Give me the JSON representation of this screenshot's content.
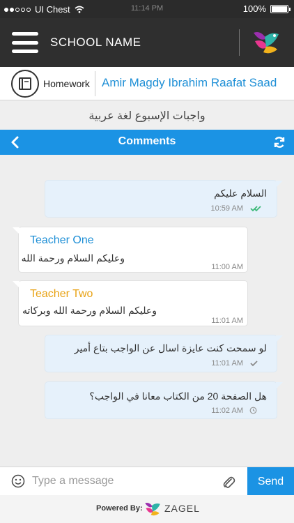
{
  "status_bar": {
    "carrier": "UI Chest",
    "time": "11:14 PM",
    "battery": "100%"
  },
  "header": {
    "school_name": "SCHOOL NAME"
  },
  "sub_header": {
    "section_label": "Homework",
    "student_name": "Amir Magdy Ibrahim Raafat Saad"
  },
  "homework_title": "واجبات الإسبوع لغة عربية",
  "comments_bar": {
    "title": "Comments"
  },
  "messages": [
    {
      "direction": "out",
      "text": "السلام عليكم",
      "time": "10:59 AM",
      "status": "read"
    },
    {
      "direction": "in",
      "sender": "Teacher One",
      "sender_color": "#1e8fd6",
      "text": "وعليكم السلام ورحمة الله",
      "time": "11:00 AM"
    },
    {
      "direction": "in",
      "sender": "Teacher Two",
      "sender_color": "#e8a214",
      "text": "وعليكم السلام ورحمة الله وبركاته",
      "time": "11:01 AM"
    },
    {
      "direction": "out",
      "text": "لو سمحت كنت عايزة اسال عن الواجب بتاع أمير",
      "time": "11:01 AM",
      "status": "sent"
    },
    {
      "direction": "out",
      "text": "هل الصفحة 20 من الكتاب معانا في الواجب؟",
      "time": "11:02 AM",
      "status": "pending"
    }
  ],
  "input": {
    "placeholder": "Type a message",
    "value": "",
    "send_label": "Send"
  },
  "footer": {
    "powered_by": "Powered By:",
    "brand": "ZAGEL"
  },
  "colors": {
    "accent": "#1b93e4",
    "header_bg": "#2f2f2f",
    "out_bubble": "#e6f1fb",
    "read_check": "#3cb878"
  },
  "icons": [
    "menu-icon",
    "app-logo-icon",
    "book-icon",
    "back-arrow-icon",
    "refresh-icon",
    "emoji-icon",
    "attachment-icon",
    "double-check-icon",
    "single-check-icon",
    "clock-icon"
  ]
}
